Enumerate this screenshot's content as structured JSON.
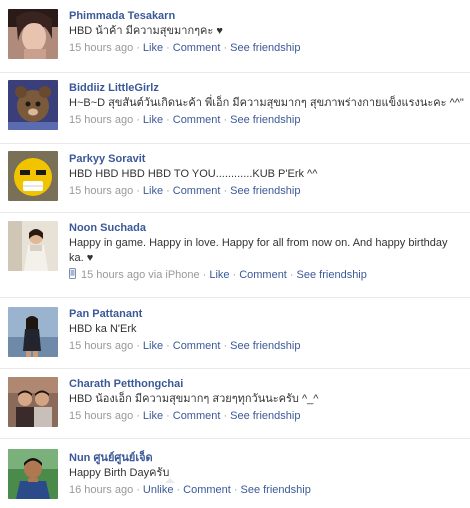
{
  "colors": {
    "link": "#3b5998",
    "meta": "#999999",
    "text": "#333333",
    "divider": "#e9e9e9"
  },
  "posts": [
    {
      "author": "Phimmada Tesakarn",
      "message": "HBD น้าค้า มีความสุขมากๆคะ ♥",
      "time": "15 hours ago",
      "actions": {
        "like": "Like",
        "comment": "Comment",
        "friendship": "See friendship"
      }
    },
    {
      "author": "Biddiiz LittleGirlz",
      "message": "H~B~D สุขสันต์วันเกิดนะค้า พี่เอ็ก มีความสุขมากๆ สุขภาพร่างกายแข็งแรงนะคะ ^^\"",
      "time": "15 hours ago",
      "actions": {
        "like": "Like",
        "comment": "Comment",
        "friendship": "See friendship"
      }
    },
    {
      "author": "Parkyy Soravit",
      "message": "HBD HBD HBD HBD TO YOU............KUB P'Erk ^^",
      "time": "15 hours ago",
      "actions": {
        "like": "Like",
        "comment": "Comment",
        "friendship": "See friendship"
      }
    },
    {
      "author": "Noon Suchada",
      "message": "Happy in game. Happy in love. Happy for all from now on. And happy birthday ka. ♥",
      "time": "15 hours ago via iPhone",
      "mobile_icon": "mobile-phone-icon",
      "actions": {
        "like": "Like",
        "comment": "Comment",
        "friendship": "See friendship"
      }
    },
    {
      "author": "Pan Pattanant",
      "message": "HBD ka N'Erk",
      "time": "15 hours ago",
      "actions": {
        "like": "Like",
        "comment": "Comment",
        "friendship": "See friendship"
      }
    },
    {
      "author": "Charath Petthongchai",
      "message": "HBD น้องเอ็ก มีความสุขมากๆ สวยๆทุกวันนะครับ ^_^",
      "time": "15 hours ago",
      "actions": {
        "like": "Like",
        "comment": "Comment",
        "friendship": "See friendship"
      }
    },
    {
      "author": "Nun ศูนย์ศูนย์เจ็ด",
      "message": "Happy Birth Dayครับ",
      "time": "16 hours ago",
      "actions": {
        "like": "Unlike",
        "comment": "Comment",
        "friendship": "See friendship"
      }
    }
  ]
}
